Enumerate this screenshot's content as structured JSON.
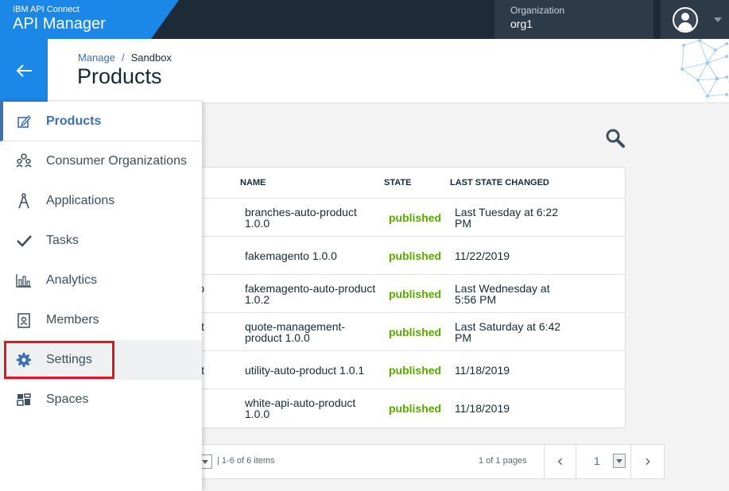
{
  "app": {
    "product_small": "IBM API Connect",
    "product_name": "API Manager"
  },
  "org": {
    "label": "Organization",
    "value": "org1"
  },
  "header": {
    "breadcrumb": [
      "Manage",
      "Sandbox"
    ],
    "breadcrumb_sep": "/",
    "title": "Products"
  },
  "back_icon": "arrow-left-icon",
  "sidebar": {
    "items": [
      {
        "label": "Products",
        "icon": "edit-icon",
        "active": true
      },
      {
        "label": "Consumer Organizations",
        "icon": "organizations-icon"
      },
      {
        "label": "Applications",
        "icon": "compass-icon"
      },
      {
        "label": "Tasks",
        "icon": "checkmark-icon"
      },
      {
        "label": "Analytics",
        "icon": "bar-chart-icon"
      },
      {
        "label": "Members",
        "icon": "badge-icon"
      },
      {
        "label": "Settings",
        "icon": "gear-icon",
        "highlighted": true
      },
      {
        "label": "Spaces",
        "icon": "grid-icon"
      }
    ]
  },
  "table": {
    "columns": [
      "NAME",
      "STATE",
      "LAST STATE CHANGED"
    ],
    "rows": [
      {
        "left": "",
        "name": "branches-auto-product 1.0.0",
        "state": "published",
        "changed": "Last Tuesday at 6:22 PM"
      },
      {
        "left": "",
        "name": "fakemagento 1.0.0",
        "state": "published",
        "changed": "11/22/2019"
      },
      {
        "left": "to",
        "name": "fakemagento-auto-product 1.0.2",
        "state": "published",
        "changed": "Last Wednesday at 5:56 PM"
      },
      {
        "left": "ent",
        "name": "quote-management-product 1.0.0",
        "state": "published",
        "changed": "Last Saturday at 6:42 PM"
      },
      {
        "left": "uct",
        "name": "utility-auto-product 1.0.1",
        "state": "published",
        "changed": "11/18/2019"
      },
      {
        "left": "",
        "name": "white-api-auto-product 1.0.0",
        "state": "published",
        "changed": "11/18/2019"
      }
    ]
  },
  "pagination": {
    "items_text": "| 1-6 of 6 items",
    "pages_text": "1 of 1 pages",
    "current_page": "1",
    "prev": "‹",
    "next": "›"
  },
  "colors": {
    "brand_blue": "#1b87e6",
    "top_bar": "#1d2b38",
    "link": "#3d70b2",
    "published": "#5aa700",
    "highlight": "#e0142a"
  }
}
